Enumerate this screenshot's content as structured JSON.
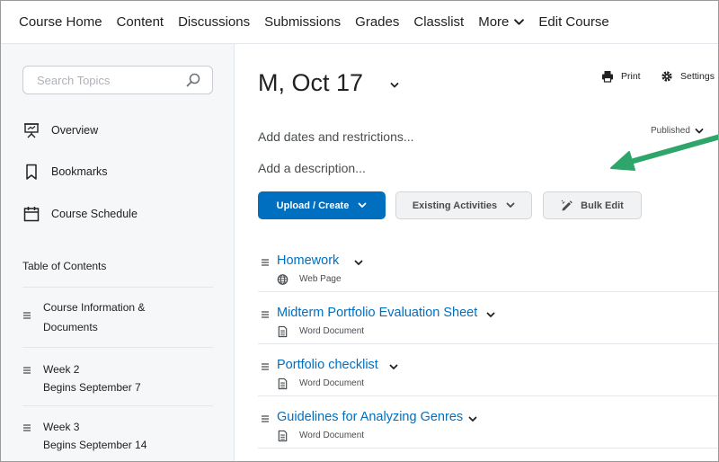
{
  "nav": {
    "items": [
      "Course Home",
      "Content",
      "Discussions",
      "Submissions",
      "Grades",
      "Classlist",
      "More",
      "Edit Course"
    ]
  },
  "sidebar": {
    "search_placeholder": "Search Topics",
    "items": [
      {
        "label": "Overview",
        "icon": "presentation-icon"
      },
      {
        "label": "Bookmarks",
        "icon": "bookmark-icon"
      },
      {
        "label": "Course Schedule",
        "icon": "calendar-icon"
      }
    ],
    "toc_heading": "Table of Contents",
    "toc": [
      {
        "line1": "Course Information &",
        "line2": "Documents"
      },
      {
        "line1": "Week 2",
        "line2": "Begins September 7"
      },
      {
        "line1": "Week 3",
        "line2": "Begins September 14"
      }
    ]
  },
  "main": {
    "title": "M, Oct 17",
    "print_label": "Print",
    "settings_label": "Settings",
    "add_dates": "Add dates and restrictions...",
    "add_description": "Add a description...",
    "published_label": "Published",
    "buttons": {
      "upload": "Upload / Create",
      "existing": "Existing Activities",
      "bulk": "Bulk Edit"
    },
    "topics": [
      {
        "name": "Homework",
        "type": "Web Page",
        "icon": "globe-icon"
      },
      {
        "name": "Midterm Portfolio Evaluation Sheet",
        "type": "Word Document",
        "icon": "document-icon"
      },
      {
        "name": "Portfolio checklist",
        "type": "Word Document",
        "icon": "document-icon"
      },
      {
        "name": "Guidelines for Analyzing Genres",
        "type": "Word Document",
        "icon": "document-icon"
      }
    ]
  },
  "colors": {
    "accent": "#006fbf",
    "annotation_arrow": "#2ea56b"
  }
}
